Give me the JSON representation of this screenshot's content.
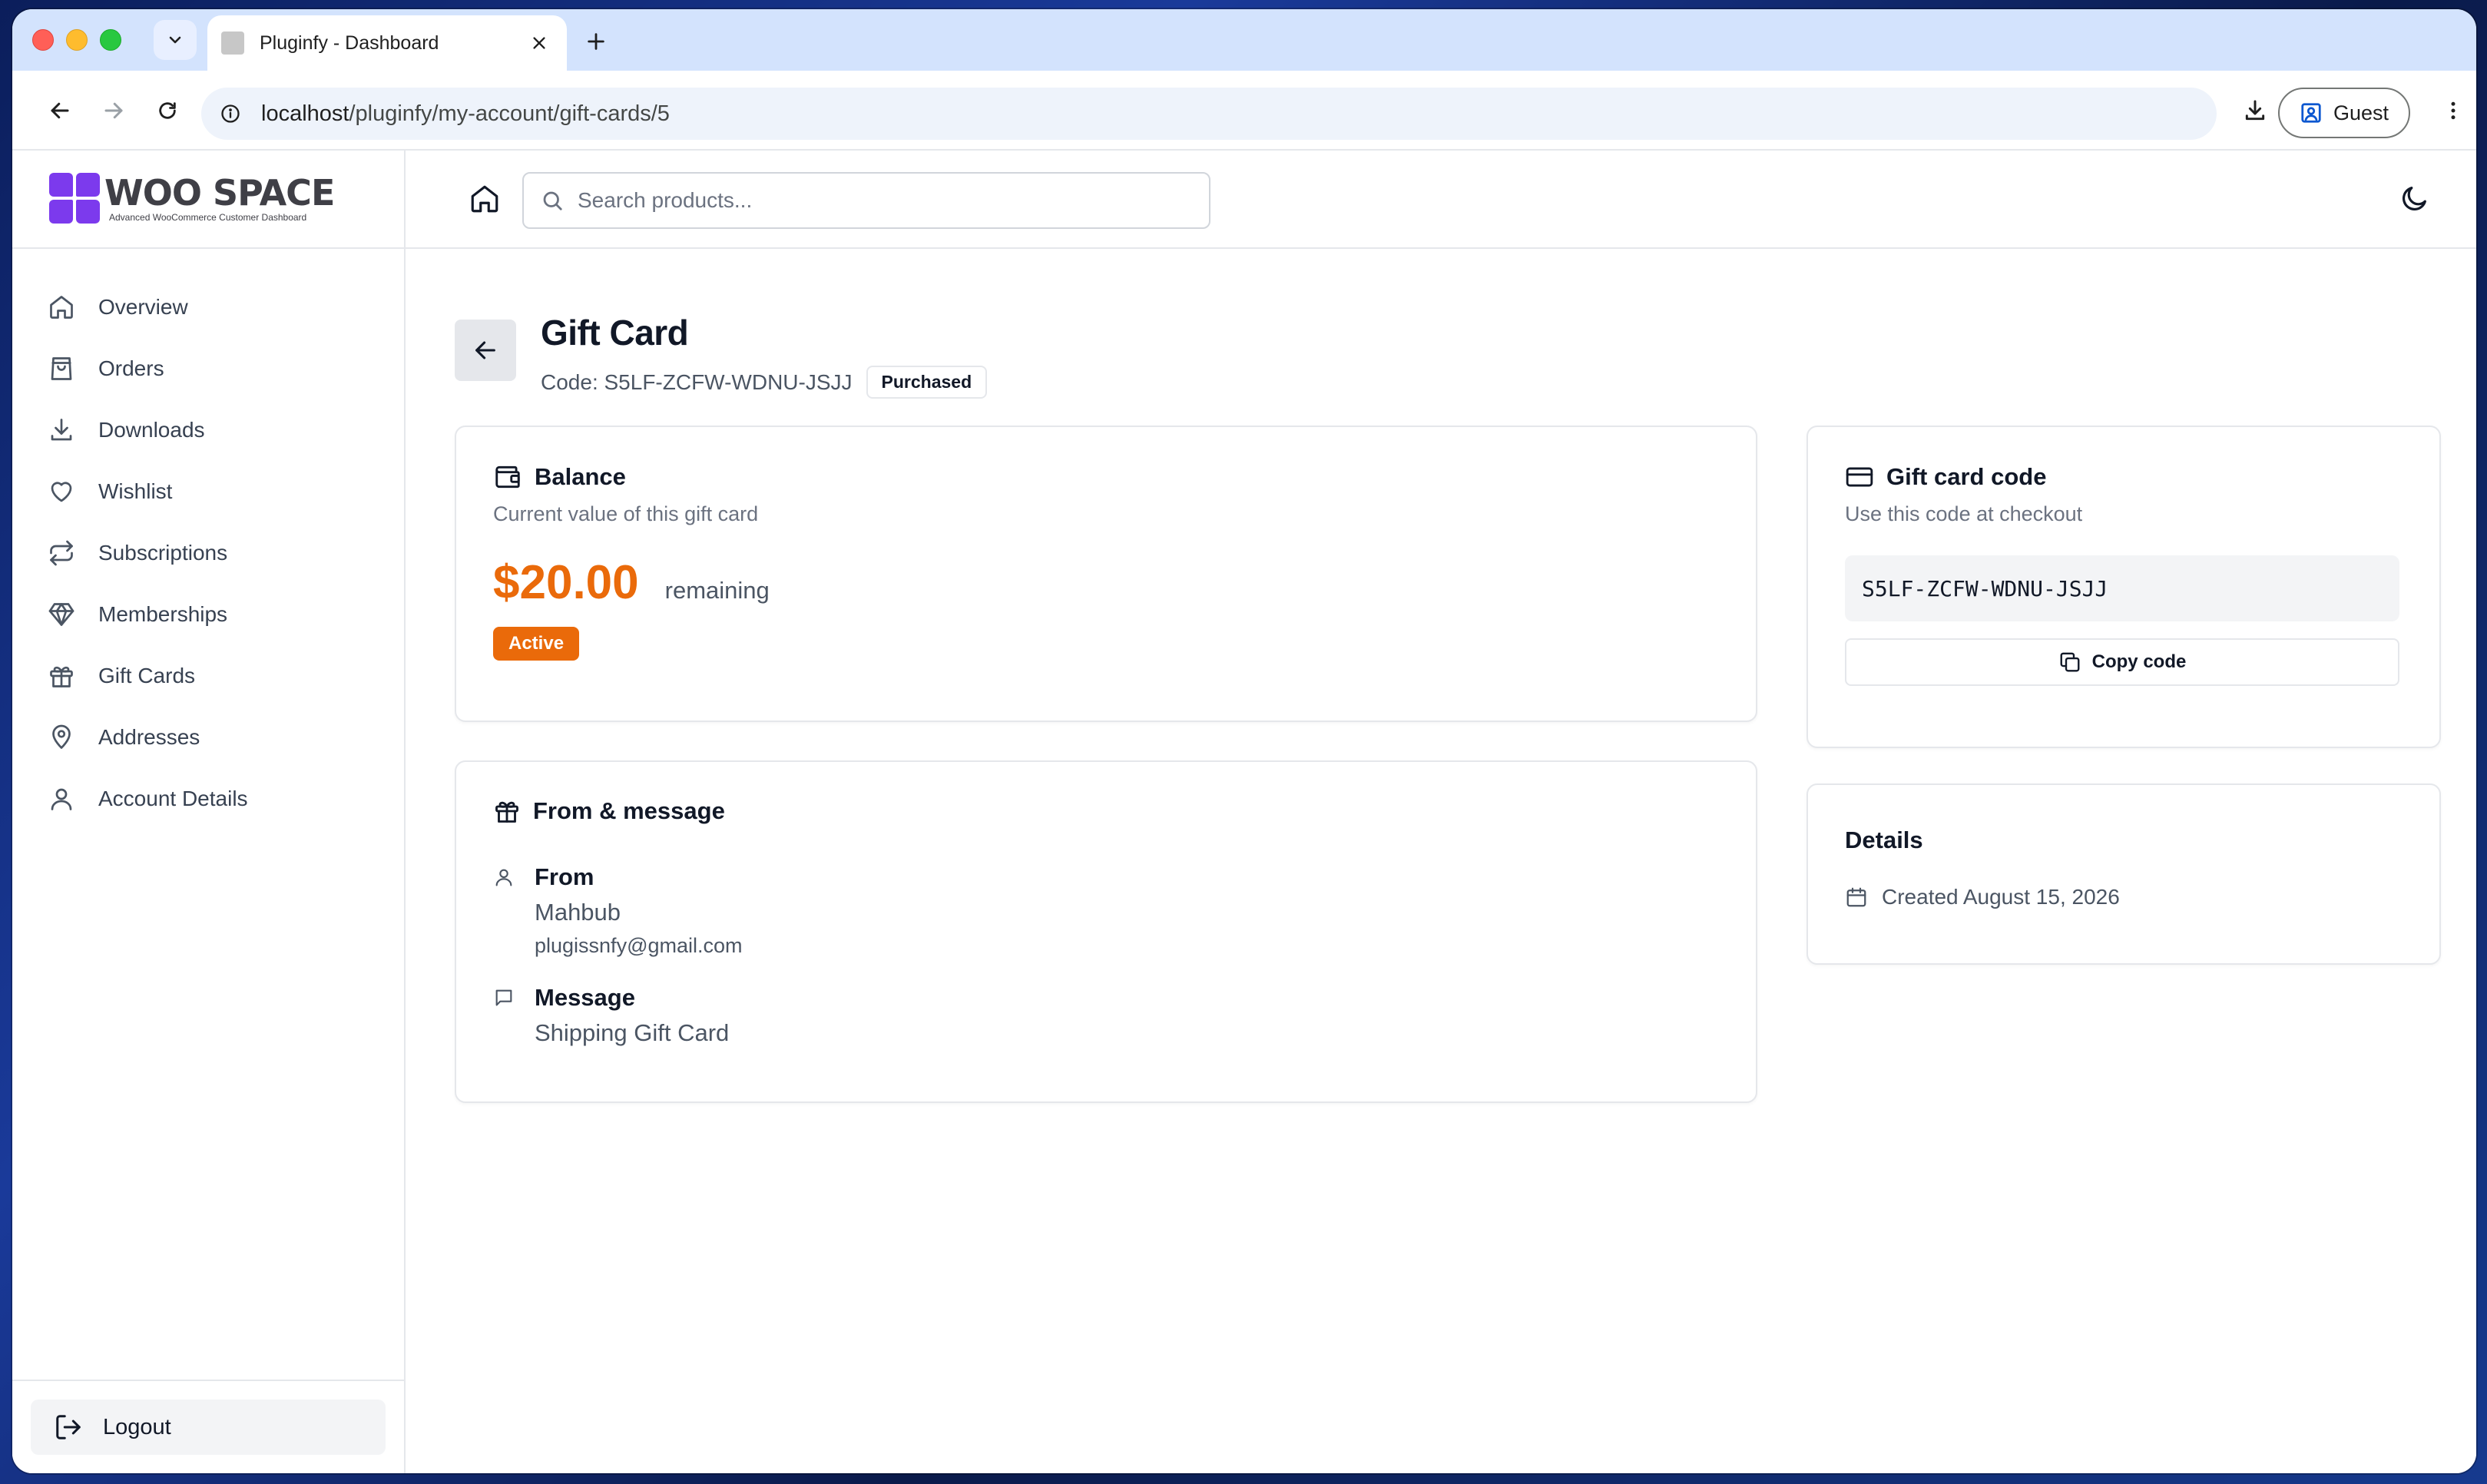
{
  "browser": {
    "tab_title": "Pluginfy - Dashboard",
    "url_host": "localhost",
    "url_path": "/pluginfy/my-account/gift-cards/5",
    "profile_label": "Guest"
  },
  "brand": {
    "name": "WOO SPACE",
    "tagline": "Advanced WooCommerce Customer Dashboard",
    "accent": "#7c3aed"
  },
  "sidebar": {
    "items": [
      {
        "label": "Overview",
        "icon": "home-icon"
      },
      {
        "label": "Orders",
        "icon": "shopping-bag-icon"
      },
      {
        "label": "Downloads",
        "icon": "download-icon"
      },
      {
        "label": "Wishlist",
        "icon": "heart-icon"
      },
      {
        "label": "Subscriptions",
        "icon": "repeat-icon"
      },
      {
        "label": "Memberships",
        "icon": "gem-icon"
      },
      {
        "label": "Gift Cards",
        "icon": "gift-icon"
      },
      {
        "label": "Addresses",
        "icon": "map-pin-icon"
      },
      {
        "label": "Account Details",
        "icon": "user-icon"
      }
    ],
    "logout_label": "Logout"
  },
  "topbar": {
    "search_placeholder": "Search products..."
  },
  "page": {
    "title": "Gift Card",
    "code_label": "Code: S5LF-ZCFW-WDNU-JSJJ",
    "status_badge": "Purchased"
  },
  "balance_card": {
    "title": "Balance",
    "subtitle": "Current value of this gift card",
    "amount": "$20.00",
    "amount_suffix": "remaining",
    "status": "Active",
    "accent": "#ea6a0a"
  },
  "message_card": {
    "title": "From & message",
    "from_label": "From",
    "from_name": "Mahbub",
    "from_email": "plugissnfy@gmail.com",
    "message_label": "Message",
    "message_text": "Shipping Gift Card"
  },
  "code_card": {
    "title": "Gift card code",
    "subtitle": "Use this code at checkout",
    "code": "S5LF-ZCFW-WDNU-JSJJ",
    "copy_label": "Copy code"
  },
  "details_card": {
    "title": "Details",
    "created": "Created August 15, 2026"
  }
}
